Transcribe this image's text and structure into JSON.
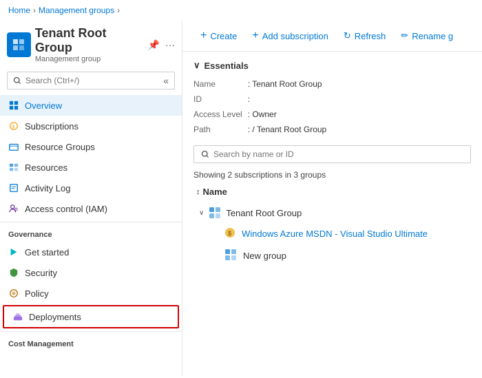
{
  "breadcrumb": {
    "items": [
      "Home",
      "Management groups"
    ]
  },
  "header": {
    "title": "Tenant Root Group",
    "subtitle": "Management group"
  },
  "sidebar": {
    "search_placeholder": "Search (Ctrl+/)",
    "nav_items": [
      {
        "id": "overview",
        "label": "Overview",
        "active": true,
        "icon": "overview"
      },
      {
        "id": "subscriptions",
        "label": "Subscriptions",
        "icon": "subscriptions"
      },
      {
        "id": "resource-groups",
        "label": "Resource Groups",
        "icon": "resource-groups"
      },
      {
        "id": "resources",
        "label": "Resources",
        "icon": "resources"
      },
      {
        "id": "activity-log",
        "label": "Activity Log",
        "icon": "activity-log"
      },
      {
        "id": "access-control",
        "label": "Access control (IAM)",
        "icon": "access-control"
      }
    ],
    "governance": {
      "label": "Governance",
      "items": [
        {
          "id": "get-started",
          "label": "Get started",
          "icon": "get-started"
        },
        {
          "id": "security",
          "label": "Security",
          "icon": "security"
        },
        {
          "id": "policy",
          "label": "Policy",
          "icon": "policy"
        },
        {
          "id": "deployments",
          "label": "Deployments",
          "icon": "deployments",
          "highlighted": true
        }
      ]
    },
    "cost_management": {
      "label": "Cost Management"
    }
  },
  "toolbar": {
    "create_label": "Create",
    "add_subscription_label": "Add subscription",
    "refresh_label": "Refresh",
    "rename_label": "Rename g"
  },
  "essentials": {
    "header": "Essentials",
    "fields": [
      {
        "label": "Name",
        "value": ": Tenant Root Group"
      },
      {
        "label": "ID",
        "value": ":"
      },
      {
        "label": "Access Level",
        "value": ": Owner"
      },
      {
        "label": "Path",
        "value": ": / Tenant Root Group"
      }
    ]
  },
  "content_search": {
    "placeholder": "Search by name or ID"
  },
  "showing_text": "Showing 2 subscriptions in 3 groups",
  "name_column": "Name",
  "tree": {
    "root": {
      "label": "Tenant Root Group",
      "children": [
        {
          "type": "subscription",
          "label": "Windows Azure MSDN - Visual Studio Ultimate",
          "link": true
        },
        {
          "type": "group",
          "label": "New group",
          "link": false
        }
      ]
    }
  }
}
